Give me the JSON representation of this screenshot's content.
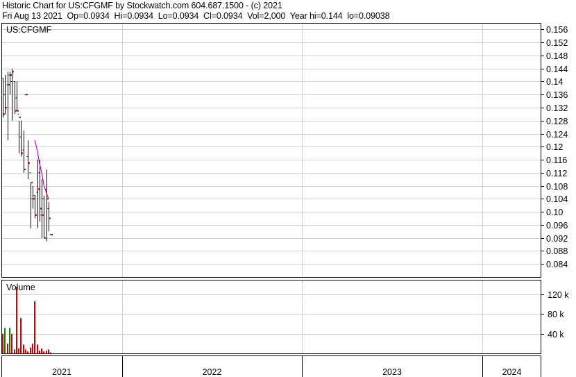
{
  "header": {
    "line1": "Historic Chart for US:CFGMF by Stockwatch.com 604.687.1500 - (c) 2021",
    "line2": "Fri Aug 13 2021  Op=0.0934  Hi=0.0934  Lo=0.0934  Cl=0.0934  Vol=2,000  Year hi=0.144  lo=0.09038"
  },
  "chart_data": [
    {
      "type": "ohlc",
      "title": "US:CFGMF",
      "ylim": [
        0.08,
        0.158
      ],
      "y_ticks": [
        "0.156",
        "0.152",
        "0.148",
        "0.144",
        "0.14",
        "0.136",
        "0.132",
        "0.128",
        "0.124",
        "0.12",
        "0.116",
        "0.112",
        "0.108",
        "0.104",
        "0.10",
        "0.096",
        "0.092",
        "0.088",
        "0.084"
      ],
      "x_ticks": [
        "2021",
        "2022",
        "2023",
        "2024"
      ],
      "grid": true,
      "colors": {
        "ohlc": "#000000",
        "close_tick": "#cc0000",
        "moving_average": "#cc00cc",
        "grid": "#d0d0d0"
      },
      "series": [
        {
          "values": [
            {
              "o": 0.141,
              "h": 0.141,
              "l": 0.129,
              "c": 0.13
            },
            {
              "o": 0.136,
              "h": 0.142,
              "l": 0.13,
              "c": 0.132
            },
            {
              "o": 0.139,
              "h": 0.143,
              "l": 0.122,
              "c": 0.139
            },
            {
              "o": 0.142,
              "h": 0.143,
              "l": 0.136,
              "c": 0.142
            },
            {
              "o": 0.14,
              "h": 0.144,
              "l": 0.128,
              "c": 0.143
            },
            {
              "o": 0.14,
              "h": 0.14,
              "l": 0.13,
              "c": 0.131
            },
            {
              "o": 0.135,
              "h": 0.14,
              "l": 0.131,
              "c": 0.131
            },
            {
              "o": 0.13,
              "h": 0.128,
              "l": 0.118,
              "c": 0.129
            },
            {
              "o": 0.123,
              "h": 0.128,
              "l": 0.117,
              "c": 0.118
            },
            {
              "o": 0.119,
              "h": 0.125,
              "l": 0.112,
              "c": 0.113
            },
            {
              "o": 0.136,
              "h": 0.136,
              "l": 0.136,
              "c": 0.136
            },
            {
              "o": 0.117,
              "h": 0.122,
              "l": 0.11,
              "c": 0.115
            },
            {
              "o": 0.112,
              "h": 0.109,
              "l": 0.095,
              "c": 0.109
            },
            {
              "o": 0.104,
              "h": 0.108,
              "l": 0.101,
              "c": 0.104
            },
            {
              "o": 0.105,
              "h": 0.105,
              "l": 0.098,
              "c": 0.099
            },
            {
              "o": 0.106,
              "h": 0.116,
              "l": 0.095,
              "c": 0.107
            },
            {
              "o": 0.112,
              "h": 0.116,
              "l": 0.097,
              "c": 0.101
            },
            {
              "o": 0.099,
              "h": 0.11,
              "l": 0.092,
              "c": 0.099
            },
            {
              "o": 0.104,
              "h": 0.105,
              "l": 0.092,
              "c": 0.092
            },
            {
              "o": 0.107,
              "h": 0.113,
              "l": 0.091,
              "c": 0.104
            },
            {
              "o": 0.101,
              "h": 0.103,
              "l": 0.094,
              "c": 0.098
            },
            {
              "o": 0.093,
              "h": 0.093,
              "l": 0.093,
              "c": 0.093
            }
          ]
        },
        {
          "name": "",
          "type": "line",
          "values": [
            0.122,
            0.119,
            0.115,
            0.112,
            0.108,
            0.106,
            0.104
          ]
        }
      ]
    },
    {
      "type": "bar",
      "title": "Volume",
      "y_ticks": [
        "120 k",
        "80 k",
        "40 k"
      ],
      "ylim": [
        0,
        150000
      ],
      "series": [
        {
          "values": [
            40000,
            52000,
            20000,
            52000,
            40000,
            8000,
            136000,
            10000,
            72000,
            18000,
            8000,
            4000,
            12000,
            20000,
            106000,
            18000,
            6000,
            10000,
            4000,
            6000,
            8000,
            2000
          ]
        }
      ]
    }
  ]
}
